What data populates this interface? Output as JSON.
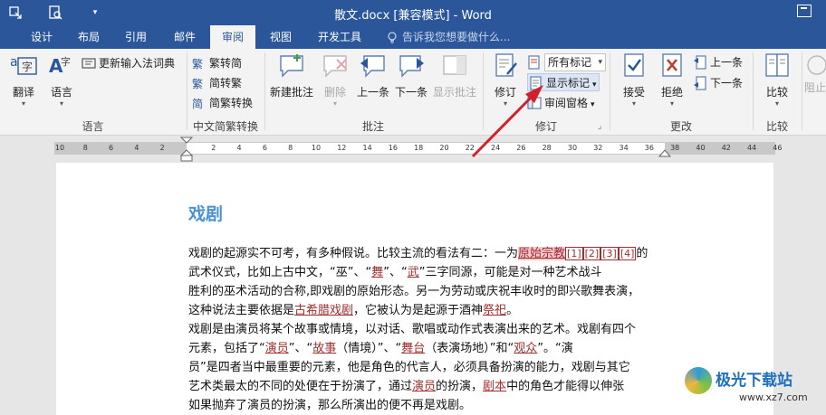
{
  "titlebar": {
    "title": "散文.docx [兼容模式] - Word",
    "qa_icons": [
      "touch-mode-icon",
      "print-preview-icon",
      "customize-qa-icon"
    ]
  },
  "tabs": [
    {
      "label": "设计"
    },
    {
      "label": "布局"
    },
    {
      "label": "引用"
    },
    {
      "label": "邮件"
    },
    {
      "label": "审阅",
      "active": true
    },
    {
      "label": "视图"
    },
    {
      "label": "开发工具"
    }
  ],
  "tell_me": "告诉我您想要做什么...",
  "ribbon": {
    "language_group": {
      "translate": "翻译",
      "language": "语言",
      "update_ime": "更新输入法词典",
      "label": "语言"
    },
    "chinese_group": {
      "trad_to_simp": "繁转简",
      "simp_to_trad": "简转繁",
      "convert": "简繁转换",
      "label": "中文简繁转换"
    },
    "comments_group": {
      "new": "新建批注",
      "delete": "删除",
      "prev": "上一条",
      "next": "下一条",
      "show": "显示批注",
      "label": "批注"
    },
    "tracking_group": {
      "track": "修订",
      "markup_select": "所有标记",
      "show_markup": "显示标记",
      "review_pane": "审阅窗格",
      "label": "修订"
    },
    "changes_group": {
      "accept": "接受",
      "reject": "拒绝",
      "prev": "上一条",
      "next": "下一条",
      "label": "更改"
    },
    "compare_group": {
      "compare": "比较",
      "label": "比较",
      "block": "阻止"
    }
  },
  "ruler_ticks": [
    "10",
    "8",
    "6",
    "4",
    "2",
    "",
    "2",
    "4",
    "6",
    "8",
    "10",
    "12",
    "14",
    "16",
    "18",
    "20",
    "22",
    "24",
    "26",
    "28",
    "30",
    "32",
    "34",
    "36",
    "38",
    "40",
    "42",
    "44",
    "46"
  ],
  "document": {
    "heading": "戏剧",
    "lines": [
      {
        "a": "戏剧的起源实不可考，有多种假说。比较主流的看法有二：一为",
        "mark": "原始宗教",
        "refs": [
          "[1]",
          "[2]",
          "[3]",
          "[4]"
        ],
        "b": "的"
      },
      {
        "a": "武术仪式，比如上古中文，“巫”、“",
        "i1": "舞",
        "c": "”、“",
        "i2": "武",
        "d": "”三字同源，可能是对一种艺术战斗"
      },
      {
        "a": "胜利的巫术活动的合称,即戏剧的原始形态。另一为劳动或庆祝丰收时的即兴歌舞表演，"
      },
      {
        "a": "这种说法主要依据是",
        "i1": "古希腊戏剧",
        "c": "，它被认为是起源于酒神",
        "i2": "祭祀",
        "d": "。"
      },
      {
        "a": "戏剧是由演员将某个故事或情境，以对话、歌唱或动作式表演出来的艺术。戏剧有四个"
      },
      {
        "a": "元素，包括了“",
        "i1": "演员",
        "c": "”、“",
        "i2": "故事",
        "d": "（情境）”、“",
        "i3": "舞台",
        "e": "（表演场地）”和“",
        "i4": "观众",
        "f": "”。“演"
      },
      {
        "a": "员”是四者当中最重要的元素，他是角色的代言人，必须具备扮演的能力，戏剧与其它"
      },
      {
        "a": "艺术类最太的不同的处便在于扮演了，通过",
        "i1": "演员",
        "c": "的扮演，",
        "i2": "剧本",
        "d": "中的角色才能得以伸张"
      },
      {
        "a": "如果抛弃了演员的扮演，那么所演出的便不再是戏剧。"
      }
    ]
  },
  "watermark": {
    "name": "极光下载站",
    "url": "www.xz7.com"
  },
  "colors": {
    "brand": "#2b579a",
    "heading": "#4a90d6",
    "revision": "#a0302f",
    "arrow": "#d0212a"
  }
}
